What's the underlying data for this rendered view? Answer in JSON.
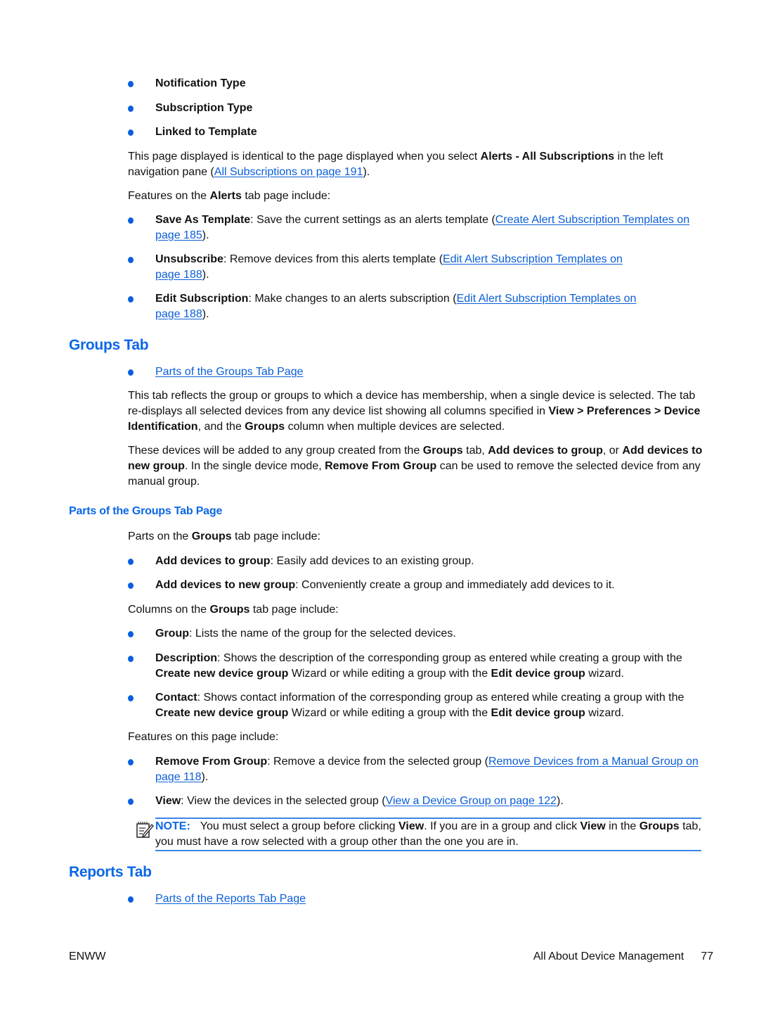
{
  "top_bullets": [
    {
      "label": "Notification Type"
    },
    {
      "label": "Subscription Type"
    },
    {
      "label": "Linked to Template"
    }
  ],
  "alerts": {
    "intro_pre": "This page displayed is identical to the page displayed when you select ",
    "intro_bold": "Alerts - All Subscriptions",
    "intro_mid": " in the left navigation pane (",
    "intro_link": "All Subscriptions on page 191",
    "intro_post": ").",
    "features_pre": "Features on the ",
    "features_bold": "Alerts",
    "features_post": " tab page include:",
    "features": [
      {
        "term": "Save As Template",
        "text": ": Save the current settings as an alerts template (",
        "link": "Create Alert Subscription Templates on page 185",
        "post": ")."
      },
      {
        "term": "Unsubscribe",
        "text": ": Remove devices from this alerts template (",
        "link": "Edit Alert Subscription Templates on page 188",
        "post": ")."
      },
      {
        "term": "Edit Subscription",
        "text": ": Make changes to an alerts subscription (",
        "link": "Edit Alert Subscription Templates on page 188",
        "post": ")."
      }
    ]
  },
  "groups": {
    "heading": "Groups Tab",
    "toc_link": "Parts of the Groups Tab Page",
    "p1": {
      "a": "This tab reflects the group or groups to which a device has membership, when a single device is selected. The tab re-displays all selected devices from any device list showing all columns specified in ",
      "b1": "View > Preferences > Device Identification",
      "c": ", and the ",
      "b2": "Groups",
      "d": " column when multiple devices are selected."
    },
    "p2": {
      "a": "These devices will be added to any group created from the ",
      "b1": "Groups",
      "c": " tab, ",
      "b2": "Add devices to group",
      "d": ", or ",
      "b3": "Add devices to new group",
      "e": ". In the single device mode, ",
      "b4": "Remove From Group",
      "f": " can be used to remove the selected device from any manual group."
    },
    "subheading": "Parts of the Groups Tab Page",
    "parts_pre": "Parts on the ",
    "parts_bold": "Groups",
    "parts_post": " tab page include:",
    "parts": [
      {
        "term": "Add devices to group",
        "text": ": Easily add devices to an existing group."
      },
      {
        "term": "Add devices to new group",
        "text": ": Conveniently create a group and immediately add devices to it."
      }
    ],
    "columns_pre": "Columns on the ",
    "columns_bold": "Groups",
    "columns_post": " tab page include:",
    "columns": [
      {
        "term": "Group",
        "text": ": Lists the name of the group for the selected devices."
      },
      {
        "term": "Description",
        "text": ": Shows the description of the corresponding group as entered while creating a group with the ",
        "b1": "Create new device group",
        "mid": " Wizard or while editing a group with the ",
        "b2": "Edit device group",
        "end": " wizard."
      },
      {
        "term": "Contact",
        "text": ": Shows contact information of the corresponding group as entered while creating a group with the ",
        "b1": "Create new device group",
        "mid": " Wizard or while editing a group with the ",
        "b2": "Edit device group",
        "end": " wizard."
      }
    ],
    "features_intro": "Features on this page include:",
    "features": [
      {
        "term": "Remove From Group",
        "text": ": Remove a device from the selected group (",
        "link": "Remove Devices from a Manual Group on page 118",
        "post": ")."
      },
      {
        "term": "View",
        "text": ": View the devices in the selected group (",
        "link": "View a Device Group on page 122",
        "post": ")."
      }
    ],
    "note": {
      "icon": "note-pencil-icon",
      "label": "NOTE:",
      "a": "You must select a group before clicking ",
      "b1": "View",
      "c": ". If you are in a group and click ",
      "b2": "View",
      "d": " in the ",
      "b3": "Groups",
      "e": " tab, you must have a row selected with a group other than the one you are in."
    }
  },
  "reports": {
    "heading": "Reports Tab",
    "toc_link": "Parts of the Reports Tab Page"
  },
  "footer": {
    "left": "ENWW",
    "section": "All About Device Management",
    "page": "77"
  },
  "colors": {
    "accent": "#0b67e6",
    "link": "#0b5ed7",
    "text": "#111111"
  }
}
